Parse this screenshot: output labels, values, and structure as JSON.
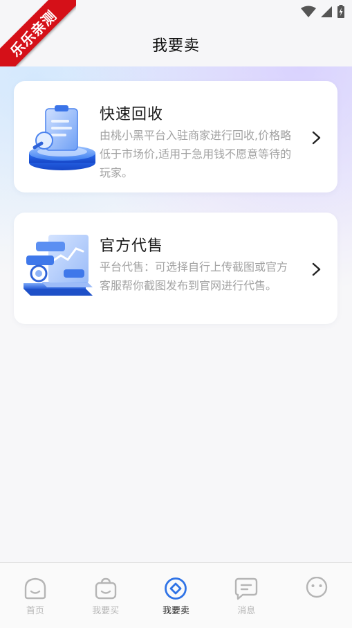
{
  "header": {
    "title": "我要卖",
    "ribbon_text": "乐乐亲测"
  },
  "cards": [
    {
      "title": "快速回收",
      "description": "由桃小黑平台入驻商家进行回收,价格略低于市场价,适用于急用钱不愿意等待的玩家。",
      "illustration": "clipboard-pedestal-illustration",
      "chevron": "chevron-right-icon"
    },
    {
      "title": "官方代售",
      "description": "平台代售：可选择自行上传截图或官方客服帮你截图发布到官网进行代售。",
      "illustration": "chart-platform-illustration",
      "chevron": "chevron-right-icon"
    }
  ],
  "nav": {
    "items": [
      {
        "label": "首页",
        "icon": "home-icon",
        "active": false
      },
      {
        "label": "我要买",
        "icon": "shopping-bag-icon",
        "active": false
      },
      {
        "label": "我要卖",
        "icon": "sell-icon",
        "active": true
      },
      {
        "label": "消息",
        "icon": "message-icon",
        "active": false
      },
      {
        "label": "",
        "icon": "profile-face-icon",
        "active": false
      }
    ]
  },
  "colors": {
    "accent": "#2f73e6",
    "ribbon": "#d51018",
    "inactive": "#b5b5b5"
  }
}
